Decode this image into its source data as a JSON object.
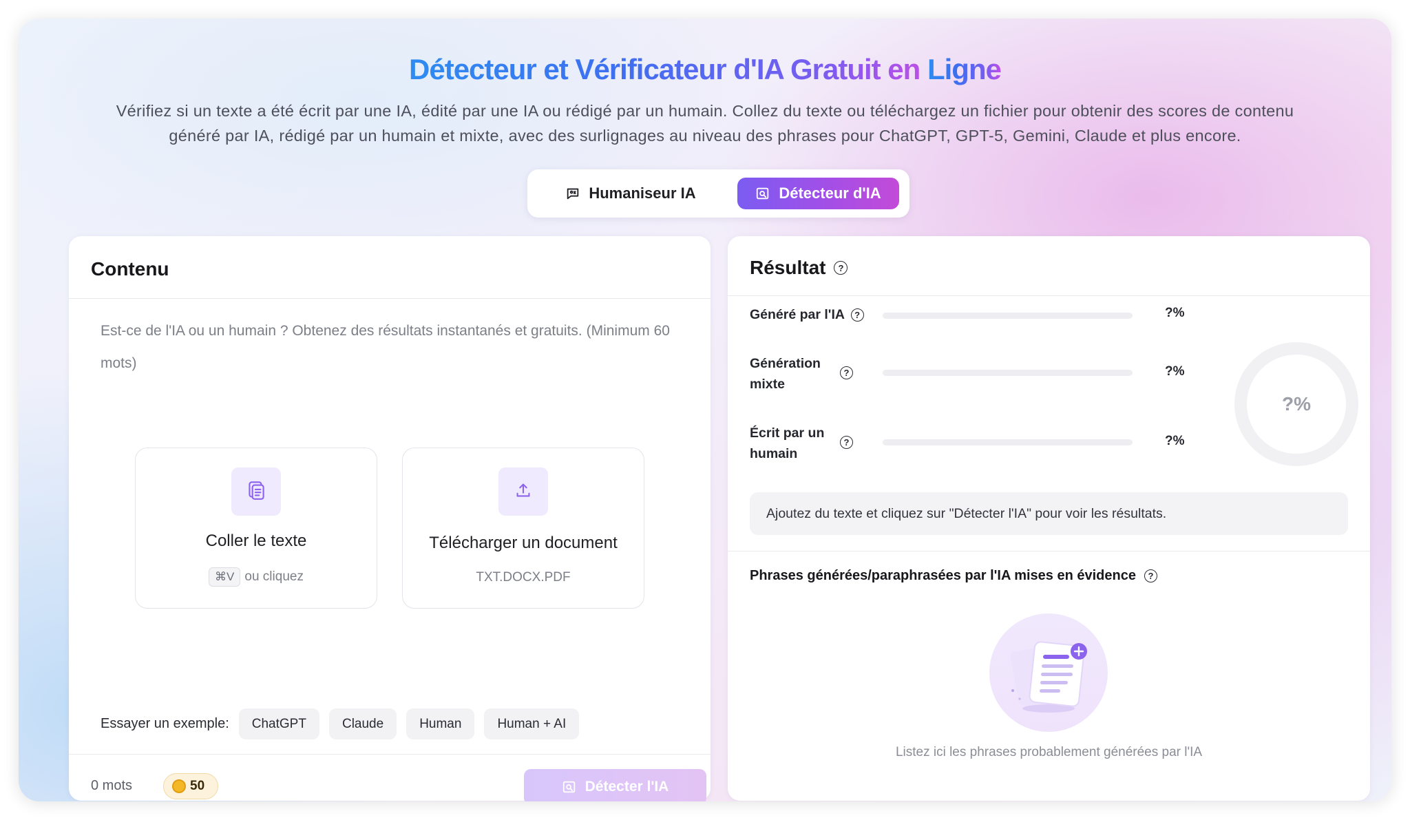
{
  "header": {
    "title_main": "Détecteur et Vérificateur d'IA Gratuit en ",
    "title_accent": "Ligne",
    "subtitle": "Vérifiez si un texte a été écrit par une IA, édité par une IA ou rédigé par un humain. Collez du texte ou téléchargez un fichier pour obtenir des scores de contenu généré par IA, rédigé par un humain et mixte, avec des surlignages au niveau des phrases pour ChatGPT, GPT-5, Gemini, Claude et plus encore."
  },
  "mode_switch": {
    "humanizer_label": "Humaniseur IA",
    "detector_label": "Détecteur d'IA",
    "active": "detector"
  },
  "content_panel": {
    "title": "Contenu",
    "placeholder": "Est-ce de l'IA ou un humain ? Obtenez des résultats instantanés et gratuits. (Minimum 60 mots)",
    "paste": {
      "label": "Coller le texte",
      "shortcut": "⌘V",
      "hint": "ou cliquez"
    },
    "upload": {
      "label": "Télécharger un document",
      "formats": "TXT.DOCX.PDF"
    },
    "examples": {
      "label": "Essayer un exemple:",
      "items": [
        "ChatGPT",
        "Claude",
        "Human",
        "Human + AI"
      ]
    },
    "word_count": "0 mots",
    "credits": "50",
    "detect_button": "Détecter l'IA"
  },
  "result_panel": {
    "title": "Résultat",
    "metrics": [
      {
        "label": "Généré par l'IA",
        "value": "?%"
      },
      {
        "label": "Génération mixte",
        "value": "?%"
      },
      {
        "label": "Écrit par un humain",
        "value": "?%"
      }
    ],
    "ring_value": "?%",
    "notice": "Ajoutez du texte et cliquez sur \"Détecter l'IA\" pour voir les résultats.",
    "phrases_title": "Phrases générées/paraphrasées par l'IA mises en évidence",
    "empty_text": "Listez ici les phrases probablement générées par l'IA"
  },
  "colors": {
    "accent_purple": "#7b5cf2",
    "accent_pink": "#c34bd8",
    "title_blue": "#2f8cf0",
    "coin_gold": "#f4b826"
  }
}
